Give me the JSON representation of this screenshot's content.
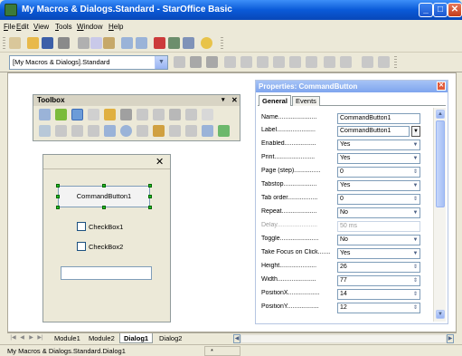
{
  "window": {
    "title": "My Macros & Dialogs.Standard - StarOffice Basic"
  },
  "menubar": {
    "items": [
      "File",
      "Edit",
      "View",
      "Tools",
      "Window",
      "Help"
    ]
  },
  "library_selector": {
    "value": "[My Macros & Dialogs].Standard"
  },
  "toolbox": {
    "title": "Toolbox"
  },
  "dialog_editor": {
    "controls": {
      "command_button": "CommandButton1",
      "checkbox1": "CheckBox1",
      "checkbox2": "CheckBox2"
    },
    "close_glyph": "✕"
  },
  "properties": {
    "title": "Properties: CommandButton",
    "tabs": [
      "General",
      "Events"
    ],
    "rows": [
      {
        "label": "Name......................",
        "value": "CommandButton1"
      },
      {
        "label": "Label......................",
        "value": "CommandButton1"
      },
      {
        "label": "Enabled..................",
        "value": "Yes"
      },
      {
        "label": "Print.......................",
        "value": "Yes"
      },
      {
        "label": "Page (step)...............",
        "value": "0"
      },
      {
        "label": "Tabstop...................",
        "value": "Yes"
      },
      {
        "label": "Tab order.................",
        "value": "0"
      },
      {
        "label": "Repeat....................",
        "value": "No"
      },
      {
        "label": "Delay.......................",
        "value": "50 ms"
      },
      {
        "label": "Toggle......................",
        "value": "No"
      },
      {
        "label": "Take Focus on Click.......",
        "value": "Yes"
      },
      {
        "label": "Height.....................",
        "value": "26"
      },
      {
        "label": "Width......................",
        "value": "77"
      },
      {
        "label": "PositionX..................",
        "value": "14"
      },
      {
        "label": "PositionY..................",
        "value": "12"
      }
    ]
  },
  "module_tabs": [
    "Module1",
    "Module2",
    "Dialog1",
    "Dialog2"
  ],
  "statusbar": {
    "text": "My Macros & Dialogs.Standard.Dialog1",
    "insert_mode": "*"
  },
  "colors": {
    "titlebar": "#0a5ad8",
    "props_header": "#7ea5ee",
    "handle": "#22bb22"
  }
}
